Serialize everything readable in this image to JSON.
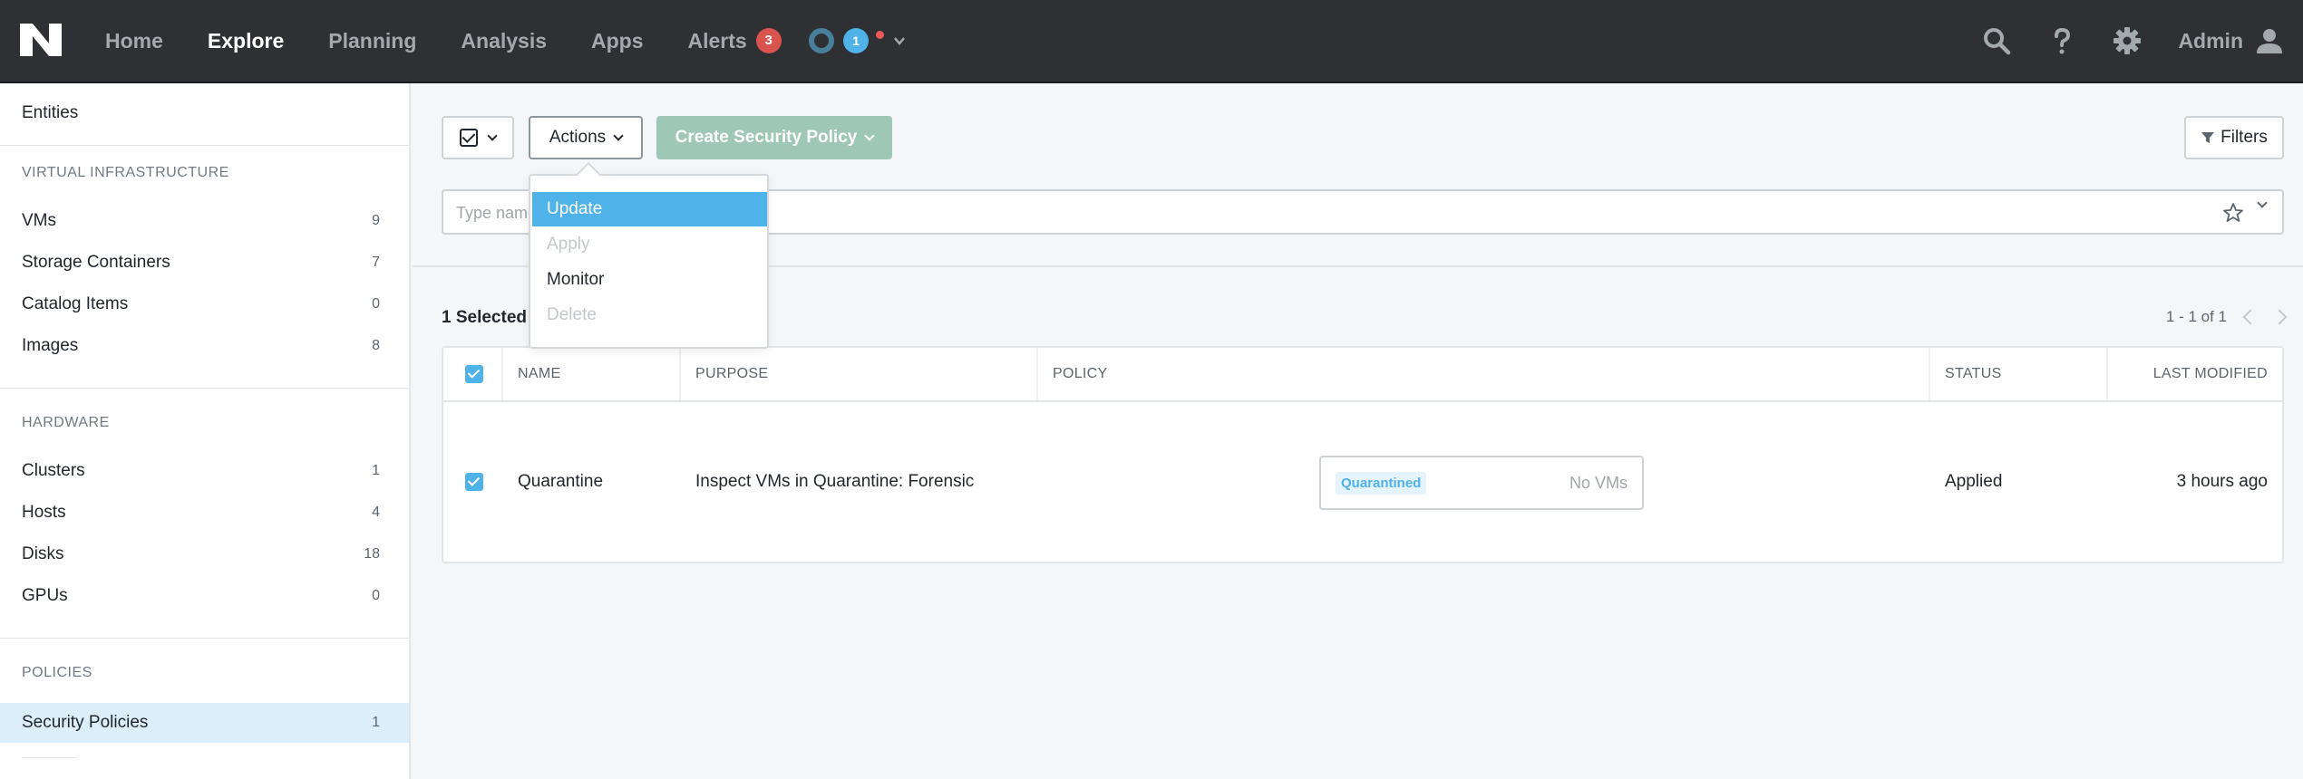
{
  "nav": {
    "items": [
      {
        "label": "Home",
        "active": false
      },
      {
        "label": "Explore",
        "active": true
      },
      {
        "label": "Planning",
        "active": false
      },
      {
        "label": "Analysis",
        "active": false
      },
      {
        "label": "Apps",
        "active": false
      },
      {
        "label": "Alerts",
        "active": false
      }
    ],
    "alerts_count": "3",
    "tasks_count": "1",
    "user_label": "Admin"
  },
  "sidebar": {
    "title": "Entities",
    "sections": [
      {
        "title": "VIRTUAL INFRASTRUCTURE",
        "items": [
          {
            "label": "VMs",
            "count": "9"
          },
          {
            "label": "Storage Containers",
            "count": "7"
          },
          {
            "label": "Catalog Items",
            "count": "0"
          },
          {
            "label": "Images",
            "count": "8"
          }
        ]
      },
      {
        "title": "HARDWARE",
        "items": [
          {
            "label": "Clusters",
            "count": "1"
          },
          {
            "label": "Hosts",
            "count": "4"
          },
          {
            "label": "Disks",
            "count": "18"
          },
          {
            "label": "GPUs",
            "count": "0"
          }
        ]
      },
      {
        "title": "POLICIES",
        "items": [
          {
            "label": "Security Policies",
            "count": "1"
          }
        ]
      }
    ]
  },
  "toolbar": {
    "actions_label": "Actions",
    "create_label": "Create Security Policy",
    "filters_label": "Filters",
    "search_placeholder": "Type name to filter"
  },
  "actions_menu": [
    {
      "label": "Update",
      "state": "highlighted"
    },
    {
      "label": "Apply",
      "state": "disabled"
    },
    {
      "label": "Monitor",
      "state": "normal"
    },
    {
      "label": "Delete",
      "state": "disabled"
    }
  ],
  "results": {
    "selected_text": "1 Selected",
    "pagination": "1 - 1 of 1"
  },
  "table": {
    "columns": [
      "NAME",
      "PURPOSE",
      "POLICY",
      "STATUS",
      "LAST MODIFIED"
    ],
    "rows": [
      {
        "name": "Quarantine",
        "purpose": "Inspect VMs in Quarantine: Forensic",
        "policy_tag": "Quarantined",
        "policy_vms": "No VMs",
        "status": "Applied",
        "last_modified": "3 hours ago"
      }
    ]
  },
  "colors": {
    "topbar": "#2f3033",
    "accent": "#4fb2e8",
    "alert": "#d9534f",
    "create_button": "#9fc7b8",
    "sidebar_selected": "#dceefa"
  }
}
